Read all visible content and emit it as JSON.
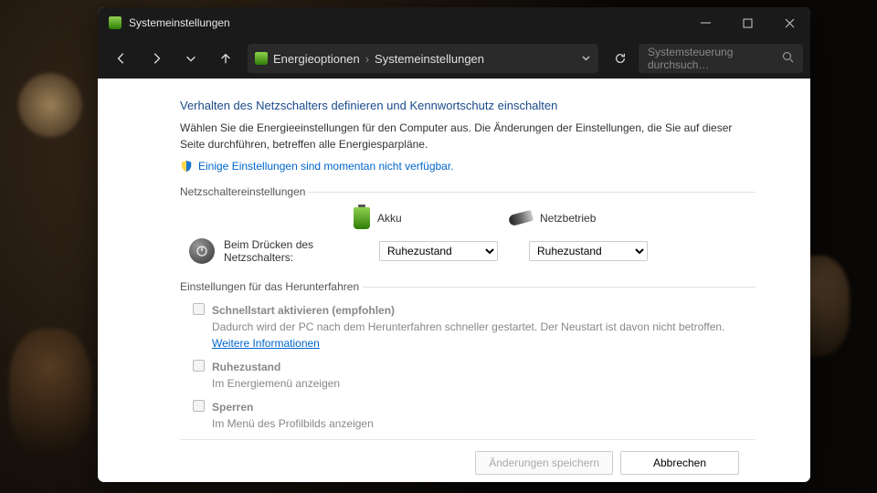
{
  "window_title": "Systemeinstellungen",
  "breadcrumb": {
    "a": "Energieoptionen",
    "b": "Systemeinstellungen"
  },
  "search": {
    "placeholder": "Systemsteuerung durchsuch…"
  },
  "heading": "Verhalten des Netzschalters definieren und Kennwortschutz einschalten",
  "intro": "Wählen Sie die Energieeinstellungen für den Computer aus. Die Änderungen der Einstellungen, die Sie auf dieser Seite durchführen, betreffen alle Energiesparpläne.",
  "admin_link": "Einige Einstellungen sind momentan nicht verfügbar.",
  "section1": "Netzschaltereinstellungen",
  "col_battery": "Akku",
  "col_plugged": "Netzbetrieb",
  "power_button_label": "Beim Drücken des Netzschalters:",
  "dropdown_value": "Ruhezustand",
  "section2": "Einstellungen für das Herunterfahren",
  "opts": {
    "fast": {
      "title": "Schnellstart aktivieren (empfohlen)",
      "desc": "Dadurch wird der PC nach dem Herunterfahren schneller gestartet. Der Neustart ist davon nicht betroffen. ",
      "link": "Weitere Informationen"
    },
    "hibernate": {
      "title": "Ruhezustand",
      "desc": "Im Energiemenü anzeigen"
    },
    "lock": {
      "title": "Sperren",
      "desc": "Im Menü des Profilbilds anzeigen"
    }
  },
  "buttons": {
    "save": "Änderungen speichern",
    "cancel": "Abbrechen"
  }
}
